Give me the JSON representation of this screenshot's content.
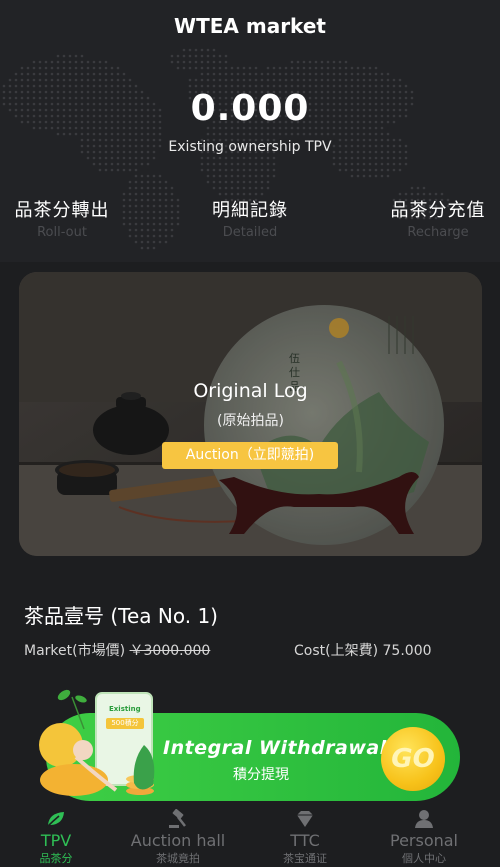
{
  "app": {
    "title": "WTEA market"
  },
  "balance": {
    "value": "0.000",
    "label": "Existing ownership TPV"
  },
  "actions": [
    {
      "zh": "品茶分轉出",
      "en": "Roll-out"
    },
    {
      "zh": "明細記錄",
      "en": "Detailed"
    },
    {
      "zh": "品茶分充值",
      "en": "Recharge"
    }
  ],
  "card": {
    "title": "Original Log",
    "subtitle": "(原始拍品)",
    "button_label": "Auction（立即競拍)",
    "cake_text": "伍仕品"
  },
  "product": {
    "name": "茶品壹号 (Tea No. 1)",
    "market_label": "Market(市場價)",
    "market_price": "￥3000.000",
    "cost_label": "Cost(上架費)",
    "cost_value": "75.000"
  },
  "banner": {
    "title": "Integral Withdrawal",
    "subtitle": "積分提現",
    "go_label": "GO",
    "phone_label": "Existing",
    "phone_value": "500積分"
  },
  "tabs": [
    {
      "main": "TPV",
      "sub": "品茶分",
      "icon": "leaf-icon",
      "active": true
    },
    {
      "main": "Auction hall",
      "sub": "茶城竟拍",
      "icon": "gavel-icon",
      "active": false
    },
    {
      "main": "TTC",
      "sub": "茶宝通证",
      "icon": "diamond-icon",
      "active": false
    },
    {
      "main": "Personal",
      "sub": "個人中心",
      "icon": "user-icon",
      "active": false
    }
  ],
  "colors": {
    "accent_green": "#2fbf55",
    "gold": "#f7c541",
    "background": "#1d1e20",
    "inactive": "#6f7073"
  }
}
